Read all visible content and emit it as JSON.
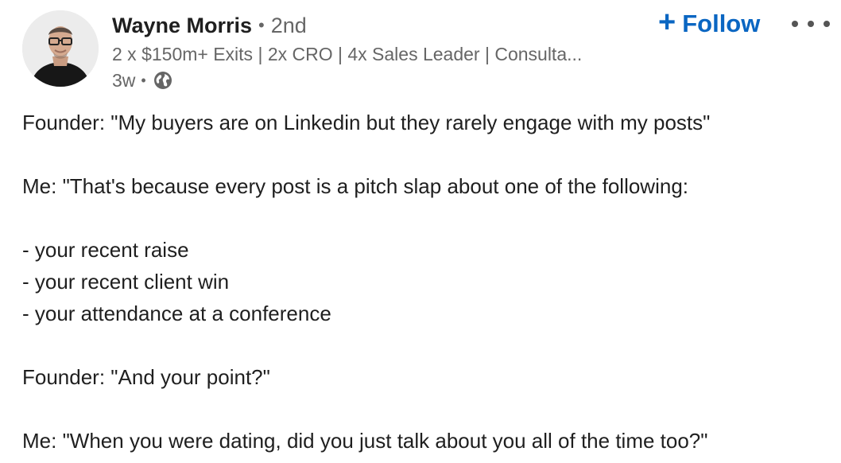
{
  "author": {
    "name": "Wayne Morris",
    "separator": "•",
    "degree": "2nd",
    "headline": "2 x $150m+ Exits | 2x CRO | 4x Sales Leader | Consulta...",
    "post_age": "3w",
    "meta_separator": "•",
    "visibility_icon": "globe-icon"
  },
  "actions": {
    "follow_icon": "+",
    "follow_label": "Follow",
    "more_icon": "more-horizontal-icon"
  },
  "post": {
    "lines": [
      "Founder: \"My buyers are on Linkedin but they rarely engage with my posts\"",
      "",
      "Me: \"That's because every post is a pitch slap about one of the following:",
      "",
      "- your recent raise",
      "- your recent client win",
      "- your attendance at a conference",
      "",
      "Founder: \"And your point?\"",
      "",
      "Me: \"When you were dating, did you just talk about you all of the time too?\""
    ]
  },
  "colors": {
    "accent": "#0a66c2",
    "primary_text": "#1f1f1f",
    "secondary_text": "#666666"
  }
}
